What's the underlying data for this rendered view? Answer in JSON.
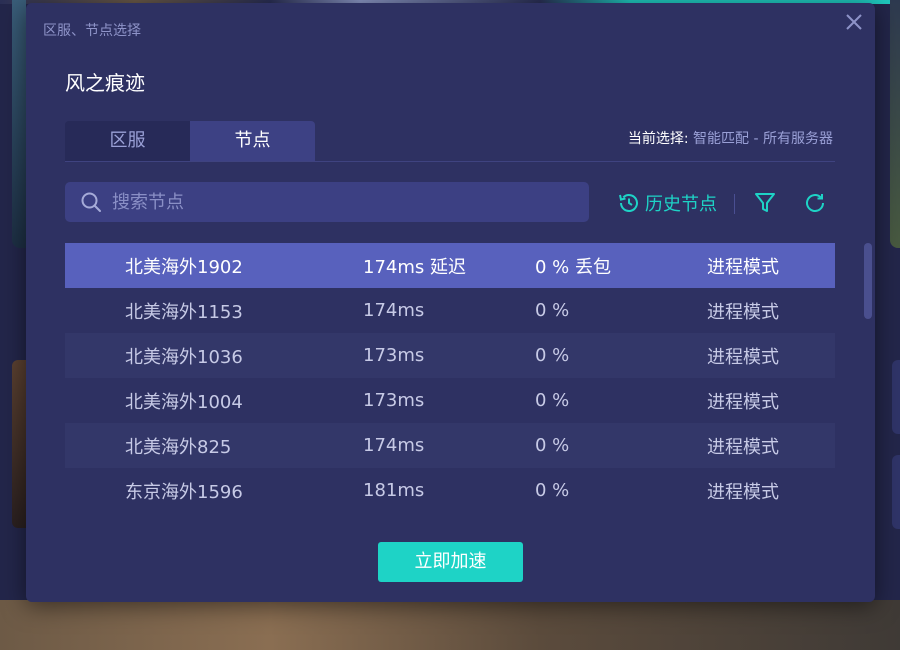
{
  "dialog": {
    "title": "区服、节点选择",
    "game_name": "风之痕迹"
  },
  "tabs": [
    {
      "label": "区服",
      "active": false
    },
    {
      "label": "节点",
      "active": true
    }
  ],
  "current_selection": {
    "label": "当前选择:",
    "value": "智能匹配 - 所有服务器"
  },
  "search": {
    "placeholder": "搜索节点",
    "value": ""
  },
  "toolbar": {
    "history_label": "历史节点"
  },
  "nodes": [
    {
      "name": "北美海外1902",
      "latency": "174ms 延迟",
      "loss": "0 % 丢包",
      "mode": "进程模式",
      "selected": true
    },
    {
      "name": "北美海外1153",
      "latency": "174ms",
      "loss": "0 %",
      "mode": "进程模式",
      "selected": false
    },
    {
      "name": "北美海外1036",
      "latency": "173ms",
      "loss": "0 %",
      "mode": "进程模式",
      "selected": false
    },
    {
      "name": "北美海外1004",
      "latency": "173ms",
      "loss": "0 %",
      "mode": "进程模式",
      "selected": false
    },
    {
      "name": "北美海外825",
      "latency": "174ms",
      "loss": "0 %",
      "mode": "进程模式",
      "selected": false
    },
    {
      "name": "东京海外1596",
      "latency": "181ms",
      "loss": "0 %",
      "mode": "进程模式",
      "selected": false
    }
  ],
  "action": {
    "accelerate_label": "立即加速"
  },
  "colors": {
    "accent": "#1ed3c6",
    "dialog_bg": "#2e3162",
    "selected_row": "#5861bd"
  }
}
